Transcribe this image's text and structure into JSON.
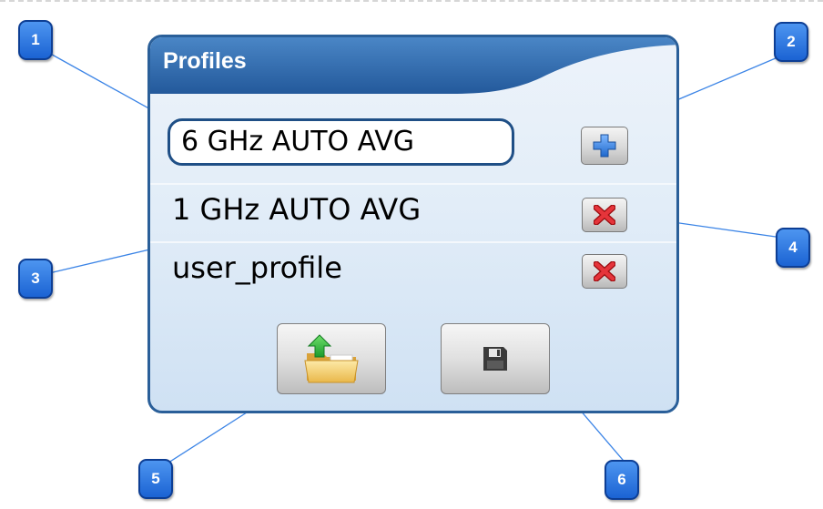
{
  "panel": {
    "title": "Profiles",
    "profile_name_value": "6 GHz AUTO AVG",
    "profiles": [
      {
        "name": "1 GHz AUTO AVG"
      },
      {
        "name": "user_profile"
      }
    ],
    "icons": {
      "add": "plus-icon",
      "delete": "red-x-icon",
      "load": "folder-upload-icon",
      "save": "floppy-disk-icon"
    }
  },
  "callouts": [
    "1",
    "2",
    "3",
    "4",
    "5",
    "6"
  ],
  "colors": {
    "panel_border": "#2a5f99",
    "header": "#2e6bb0",
    "callout": "#1b63d3",
    "leader_line": "#3b84e6",
    "delete_icon": "#d8262b",
    "add_icon": "#2f7fe0"
  }
}
